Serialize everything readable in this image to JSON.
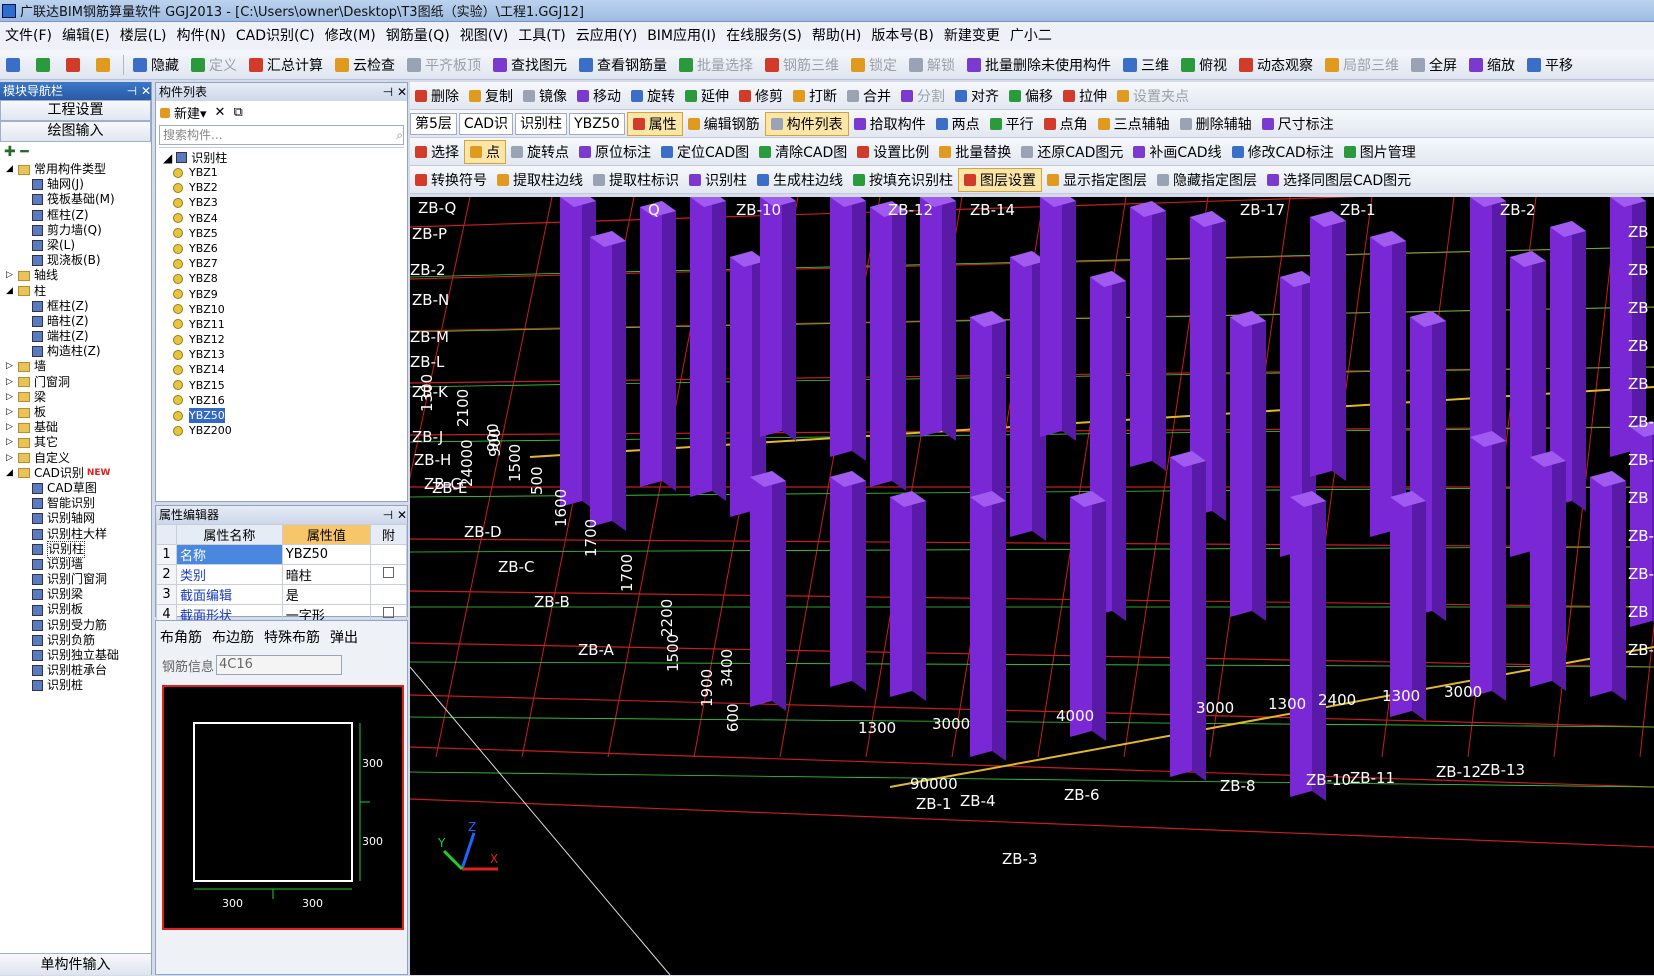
{
  "window": {
    "title": "广联达BIM钢筋算量软件 GGJ2013 - [C:\\Users\\owner\\Desktop\\T3图纸（实验）\\工程1.GGJ12]"
  },
  "menu": [
    "文件(F)",
    "编辑(E)",
    "楼层(L)",
    "构件(N)",
    "CAD识别(C)",
    "修改(M)",
    "钢筋量(Q)",
    "视图(V)",
    "工具(T)",
    "云应用(Y)",
    "BIM应用(I)",
    "在线服务(S)",
    "帮助(H)",
    "版本号(B)",
    "新建变更",
    "广小二"
  ],
  "main_toolbar": [
    "隐藏",
    "定义",
    "汇总计算",
    "云检查",
    "平齐板顶",
    "查找图元",
    "查看钢筋量",
    "批量选择",
    "钢筋三维",
    "锁定",
    "解锁",
    "批量删除未使用构件",
    "三维",
    "俯视",
    "动态观察",
    "局部三维",
    "全屏",
    "缩放",
    "平移"
  ],
  "nav": {
    "title": "模块导航栏",
    "btn_project": "工程设置",
    "btn_drawing": "绘图输入",
    "tree": [
      {
        "label": "常用构件类型",
        "type": "folder",
        "level": 0
      },
      {
        "label": "轴网(J)",
        "type": "leaf",
        "level": 1
      },
      {
        "label": "筏板基础(M)",
        "type": "leaf",
        "level": 1
      },
      {
        "label": "框柱(Z)",
        "type": "leaf",
        "level": 1
      },
      {
        "label": "剪力墙(Q)",
        "type": "leaf",
        "level": 1
      },
      {
        "label": "梁(L)",
        "type": "leaf",
        "level": 1
      },
      {
        "label": "现浇板(B)",
        "type": "leaf",
        "level": 1
      },
      {
        "label": "轴线",
        "type": "folder",
        "level": 0
      },
      {
        "label": "柱",
        "type": "folder",
        "level": 0
      },
      {
        "label": "框柱(Z)",
        "type": "leaf",
        "level": 1
      },
      {
        "label": "暗柱(Z)",
        "type": "leaf",
        "level": 1
      },
      {
        "label": "端柱(Z)",
        "type": "leaf",
        "level": 1
      },
      {
        "label": "构造柱(Z)",
        "type": "leaf",
        "level": 1
      },
      {
        "label": "墙",
        "type": "folder",
        "level": 0
      },
      {
        "label": "门窗洞",
        "type": "folder",
        "level": 0
      },
      {
        "label": "梁",
        "type": "folder",
        "level": 0
      },
      {
        "label": "板",
        "type": "folder",
        "level": 0
      },
      {
        "label": "基础",
        "type": "folder",
        "level": 0
      },
      {
        "label": "其它",
        "type": "folder",
        "level": 0
      },
      {
        "label": "自定义",
        "type": "folder",
        "level": 0
      },
      {
        "label": "CAD识别",
        "type": "folder",
        "level": 0,
        "badge": "NEW"
      },
      {
        "label": "CAD草图",
        "type": "leaf",
        "level": 1
      },
      {
        "label": "智能识别",
        "type": "leaf",
        "level": 1
      },
      {
        "label": "识别轴网",
        "type": "leaf",
        "level": 1
      },
      {
        "label": "识别柱大样",
        "type": "leaf",
        "level": 1
      },
      {
        "label": "识别柱",
        "type": "leaf",
        "level": 1,
        "selected": true
      },
      {
        "label": "识别墙",
        "type": "leaf",
        "level": 1
      },
      {
        "label": "识别门窗洞",
        "type": "leaf",
        "level": 1
      },
      {
        "label": "识别梁",
        "type": "leaf",
        "level": 1
      },
      {
        "label": "识别板",
        "type": "leaf",
        "level": 1
      },
      {
        "label": "识别受力筋",
        "type": "leaf",
        "level": 1
      },
      {
        "label": "识别负筋",
        "type": "leaf",
        "level": 1
      },
      {
        "label": "识别独立基础",
        "type": "leaf",
        "level": 1
      },
      {
        "label": "识别桩承台",
        "type": "leaf",
        "level": 1
      },
      {
        "label": "识别桩",
        "type": "leaf",
        "level": 1
      }
    ],
    "footer": "单构件输入"
  },
  "component_list": {
    "title": "构件列表",
    "new_label": "新建",
    "search_placeholder": "搜索构件...",
    "root": "识别柱",
    "items": [
      "YBZ1",
      "YBZ2",
      "YBZ3",
      "YBZ4",
      "YBZ5",
      "YBZ6",
      "YBZ7",
      "YBZ8",
      "YBZ9",
      "YBZ10",
      "YBZ11",
      "YBZ12",
      "YBZ13",
      "YBZ14",
      "YBZ15",
      "YBZ16",
      "YBZ50",
      "YBZ200"
    ],
    "selected": "YBZ50"
  },
  "property_editor": {
    "title": "属性编辑器",
    "headers": [
      "属性名称",
      "属性值",
      "附"
    ],
    "rows": [
      {
        "n": "1",
        "name": "名称",
        "value": "YBZ50",
        "check": false
      },
      {
        "n": "2",
        "name": "类别",
        "value": "暗柱",
        "check": true
      },
      {
        "n": "3",
        "name": "截面编辑",
        "value": "是",
        "check": false
      },
      {
        "n": "4",
        "name": "截面形状",
        "value": "一字形",
        "check": true
      }
    ]
  },
  "rebar_panel": {
    "tabs": [
      "布角筋",
      "布边筋",
      "特殊布筋",
      "弹出"
    ],
    "info_label": "钢筋信息",
    "info_value": "4C16",
    "dims": [
      "300",
      "300",
      "300",
      "300"
    ]
  },
  "draw_toolbar_1": [
    "删除",
    "复制",
    "镜像",
    "移动",
    "旋转",
    "延伸",
    "修剪",
    "打断",
    "合并",
    "分割",
    "对齐",
    "偏移",
    "拉伸",
    "设置夹点"
  ],
  "draw_toolbar_2": {
    "floor": "第5层",
    "cad": "CAD识",
    "type": "识别柱",
    "comp": "YBZ50",
    "buttons": [
      "属性",
      "编辑钢筋",
      "构件列表",
      "拾取构件",
      "两点",
      "平行",
      "点角",
      "三点辅轴",
      "删除辅轴",
      "尺寸标注"
    ]
  },
  "draw_toolbar_3": [
    "选择",
    "点",
    "旋转点",
    "原位标注",
    "定位CAD图",
    "清除CAD图",
    "设置比例",
    "批量替换",
    "还原CAD图元",
    "补画CAD线",
    "修改CAD标注",
    "图片管理"
  ],
  "draw_toolbar_4": [
    "转换符号",
    "提取柱边线",
    "提取柱标识",
    "识别柱",
    "生成柱边线",
    "按填充识别柱",
    "图层设置",
    "显示指定图层",
    "隐藏指定图层",
    "选择同图层CAD图元"
  ],
  "viewport": {
    "axis_labels_left": [
      "ZB-Q",
      "ZB-P",
      "ZB-2",
      "ZB-N",
      "ZB-M",
      "ZB-L",
      "ZB-K",
      "ZB-J",
      "ZB-H",
      "ZB-G",
      "ZB-E",
      "ZB-D",
      "ZB-C",
      "ZB-B",
      "ZB-A"
    ],
    "axis_labels_top": [
      "Q",
      "ZB-10",
      "ZB-12",
      "ZB-14",
      "ZB-17",
      "ZB-1",
      "ZB-2"
    ],
    "axis_labels_right": [
      "ZB",
      "ZB",
      "ZB",
      "ZB",
      "ZB",
      "ZB-1",
      "ZB-1",
      "ZB",
      "ZB-1",
      "ZB-1",
      "ZB",
      "ZB-1"
    ],
    "axis_labels_bottom": [
      "ZB-1",
      "ZB-4",
      "ZB-6",
      "ZB-8",
      "ZB-10",
      "ZB-11",
      "ZB-12",
      "ZB-13",
      "ZB-3"
    ],
    "dims_vertical": [
      "2100",
      "900",
      "24000",
      "1500",
      "500",
      "1600",
      "1700",
      "1700",
      "2200",
      "1500",
      "1900",
      "3400",
      "600",
      "1300",
      "900"
    ],
    "dims_horizontal": [
      "1300",
      "3000",
      "4000",
      "3000",
      "1300",
      "2400",
      "1300",
      "3000",
      "90000"
    ]
  }
}
